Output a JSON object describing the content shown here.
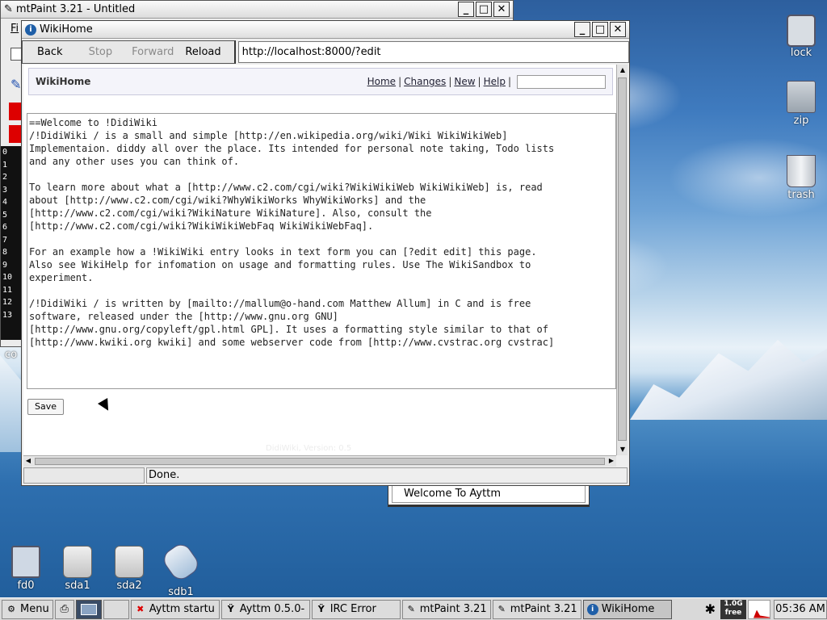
{
  "desktop": {
    "icons": [
      {
        "label": "lock"
      },
      {
        "label": "zip"
      },
      {
        "label": "trash"
      },
      {
        "label": "fd0"
      },
      {
        "label": "sda1"
      },
      {
        "label": "sda2"
      },
      {
        "label": "sdb1"
      }
    ],
    "partial_label": "co"
  },
  "mtpaint": {
    "title": "mtPaint 3.21 - Untitled",
    "menu_fragment": "Fi",
    "numbers": [
      "0",
      "1",
      "2",
      "3",
      "4",
      "5",
      "6",
      "7",
      "8",
      "9",
      "10",
      "11",
      "12",
      "13"
    ]
  },
  "browser": {
    "title": "WikiHome",
    "nav": {
      "back": "Back",
      "stop": "Stop",
      "forward": "Forward",
      "reload": "Reload"
    },
    "url": "http://localhost:8000/?edit",
    "status": "Done.",
    "page": {
      "title": "WikiHome",
      "links": {
        "home": "Home",
        "changes": "Changes",
        "new": "New",
        "help": "Help"
      },
      "sep": "|",
      "editor_lines": [
        "==Welcome to !DidiWiki",
        "/!DidiWiki / is a small and simple [http://en.wikipedia.org/wiki/Wiki WikiWikiWeb]",
        "Implementaion. diddy all over the place. Its intended for personal note taking, Todo lists",
        "and any other uses you can think of.",
        "",
        "To learn more about what a [http://www.c2.com/cgi/wiki?WikiWikiWeb WikiWikiWeb] is, read",
        "about [http://www.c2.com/cgi/wiki?WhyWikiWorks WhyWikiWorks] and the",
        "[http://www.c2.com/cgi/wiki?WikiNature WikiNature]. Also, consult the",
        "[http://www.c2.com/cgi/wiki?WikiWikiWebFaq WikiWikiWebFaq].",
        "",
        "For an example how a !WikiWiki entry looks in text form you can [?edit edit] this page.",
        "Also see WikiHelp for infomation on usage and formatting rules. Use The WikiSandbox to",
        "experiment.",
        "",
        "/!DidiWiki / is written by [mailto://mallum@o-hand.com Matthew Allum] in C and is free",
        "software, released under the [http://www.gnu.org GNU]",
        "[http://www.gnu.org/copyleft/gpl.html GPL]. It uses a formatting style similar to that of",
        "[http://www.kwiki.org kwiki] and some webserver code from [http://www.cvstrac.org cvstrac]"
      ],
      "save_label": "Save",
      "footer": "DidiWiki, Version: 0.5"
    }
  },
  "aytm_window": {
    "text": "Welcome To Ayttm"
  },
  "taskbar": {
    "menu": "Menu",
    "tasks": [
      {
        "label": "Ayttm startu",
        "icon": "x-icon"
      },
      {
        "label": "Ayttm 0.5.0-",
        "icon": "ayttm-icon"
      },
      {
        "label": "IRC Error",
        "icon": "ayttm-icon"
      },
      {
        "label": "mtPaint 3.21",
        "icon": "paint-icon"
      },
      {
        "label": "mtPaint 3.21",
        "icon": "paint-icon"
      },
      {
        "label": "WikiHome",
        "icon": "info-icon",
        "active": true
      }
    ],
    "mem": "1.0G",
    "mem_free": "free",
    "clock": "05:36 AM"
  }
}
